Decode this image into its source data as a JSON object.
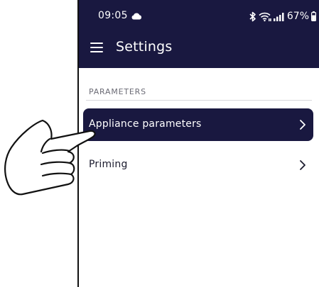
{
  "status_bar": {
    "time": "09:05",
    "battery": "67%",
    "icons": [
      "cloud-icon",
      "bluetooth-icon",
      "wifi-icon",
      "signal-icon",
      "battery-icon"
    ]
  },
  "header": {
    "title": "Settings",
    "menu_icon": "hamburger-menu-icon"
  },
  "section": {
    "label": "PARAMETERS"
  },
  "list": [
    {
      "label": "Appliance parameters",
      "selected": true
    },
    {
      "label": "Priming",
      "selected": false
    }
  ],
  "colors": {
    "header_bg": "#191840",
    "selected_row_bg": "#191840",
    "text_dark": "#1b1b2e",
    "section_label": "#6b6b75"
  }
}
